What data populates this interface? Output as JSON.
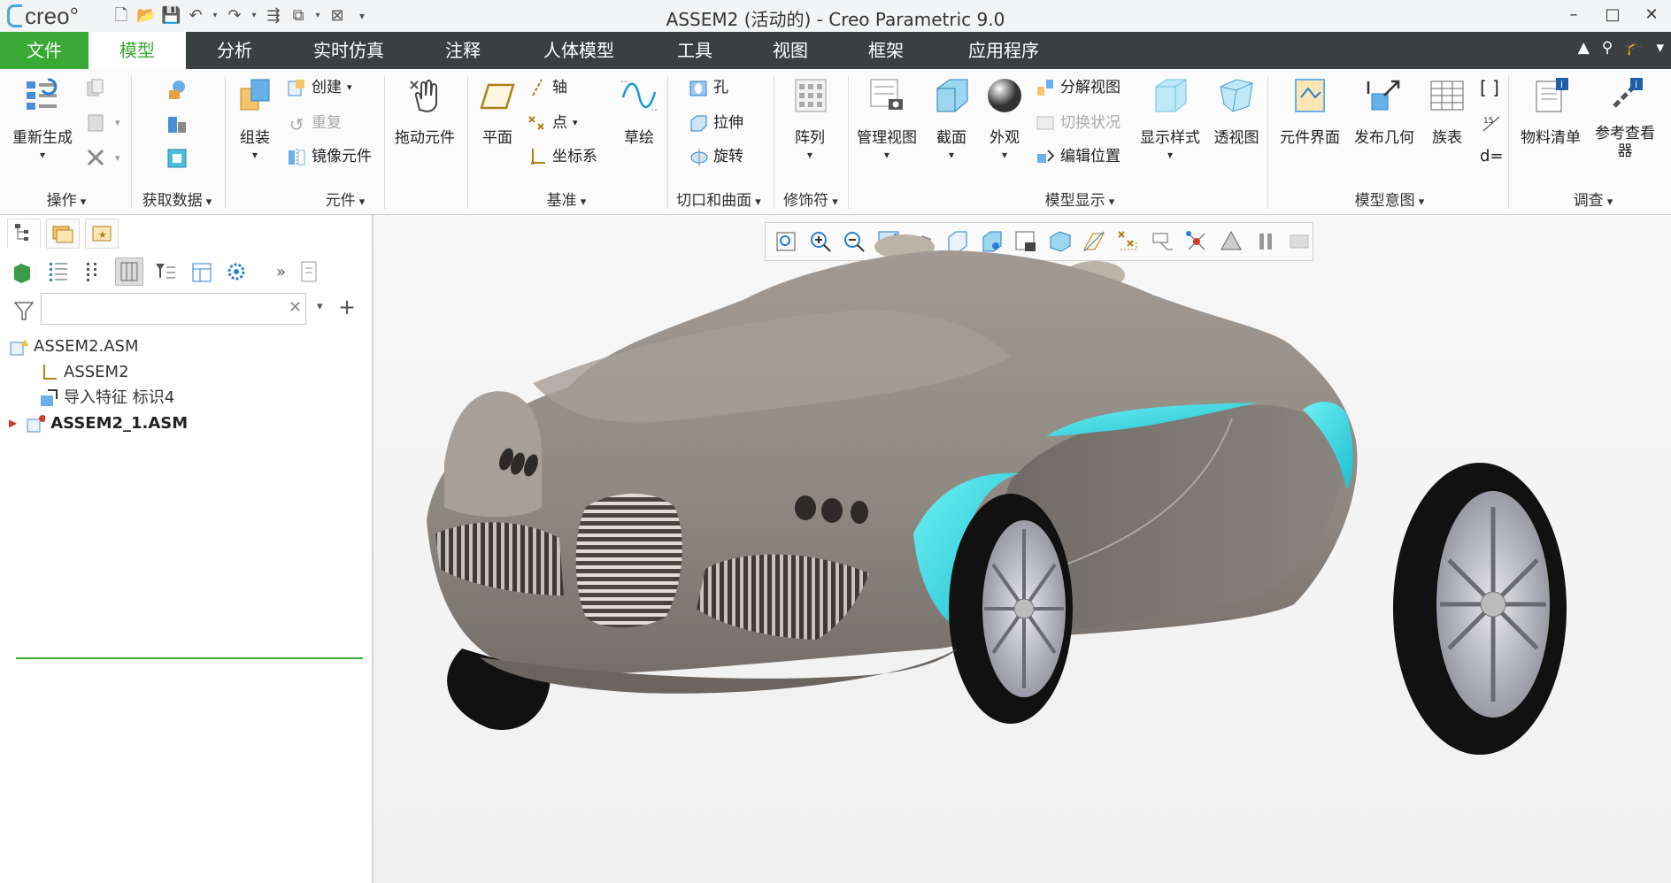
{
  "window": {
    "logo_text": "creo°",
    "title": "ASSEM2 (活动的) - Creo Parametric 9.0",
    "controls": [
      "–",
      "□",
      "✕"
    ]
  },
  "menu": {
    "tabs": [
      "文件",
      "模型",
      "分析",
      "实时仿真",
      "注释",
      "人体模型",
      "工具",
      "视图",
      "框架",
      "应用程序"
    ],
    "active": "模型"
  },
  "ribbon": {
    "ops": {
      "regenerate": "重新生成",
      "label": "操作"
    },
    "getdata": {
      "label": "获取数据"
    },
    "component": {
      "assemble": "组装",
      "create": "创建",
      "repeat": "重复",
      "mirror": "镜像元件",
      "label": "元件"
    },
    "drag": {
      "label": "拖动元件"
    },
    "datum": {
      "plane": "平面",
      "axis": "轴",
      "point": "点",
      "csys": "坐标系",
      "sketch": "草绘",
      "label": "基准"
    },
    "cut": {
      "hole": "孔",
      "extrude": "拉伸",
      "revolve": "旋转",
      "label": "切口和曲面"
    },
    "mod": {
      "pattern": "阵列",
      "label": "修饰符"
    },
    "display": {
      "manage_views": "管理视图",
      "section": "截面",
      "appearance": "外观",
      "explode": "分解视图",
      "toggle": "切换状况",
      "edit_pos": "编辑位置",
      "style": "显示样式",
      "perspective": "透视图",
      "label": "模型显示"
    },
    "intent": {
      "interface": "元件界面",
      "publish": "发布几何",
      "table": "族表",
      "label": "模型意图"
    },
    "investigate": {
      "bom": "物料清单",
      "ref_viewer": "参考查看器",
      "label": "调查"
    }
  },
  "tree": {
    "nodes": [
      {
        "label": "ASSEM2.ASM",
        "kind": "assembly"
      },
      {
        "label": "ASSEM2",
        "kind": "csys"
      },
      {
        "label": "导入特征 标识4",
        "kind": "import"
      },
      {
        "label": "ASSEM2_1.ASM",
        "kind": "subassembly"
      }
    ],
    "filter_placeholder": ""
  },
  "colors": {
    "accent": "#3aa935",
    "menubar": "#3b3f42",
    "car_body": "#8f8881",
    "car_accent": "#2fd2e0"
  }
}
